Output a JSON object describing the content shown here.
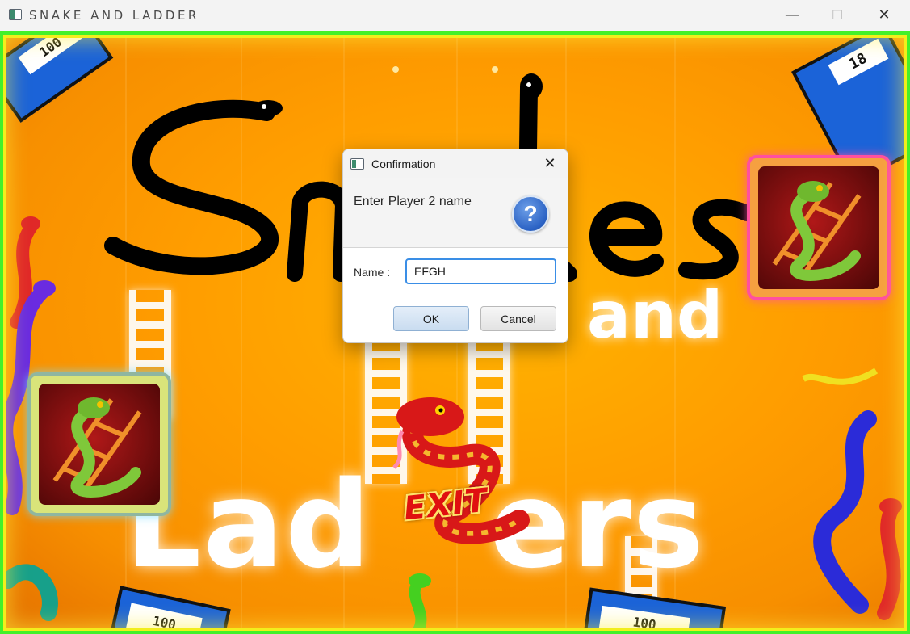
{
  "window": {
    "title": "SNAKE AND LADDER",
    "minimize_glyph": "—",
    "maximize_glyph": "☐",
    "close_glyph": "✕"
  },
  "game": {
    "title_word_1": "Snakes",
    "title_word_2": "and",
    "title_word_3_left": "Lad",
    "title_word_3_right": "ers",
    "exit_label": "EXIT",
    "board_labels": [
      "100",
      "18",
      "100",
      "100"
    ]
  },
  "dialog": {
    "title": "Confirmation",
    "close_glyph": "✕",
    "message": "Enter Player 2 name",
    "help_glyph": "?",
    "name_label": "Name :",
    "name_value": "EFGH",
    "ok_label": "OK",
    "cancel_label": "Cancel"
  },
  "colors": {
    "background_orange": "#ff9d00",
    "frame_green": "#43f02a",
    "frame_yellow": "#f2ee1c",
    "snake_title": "#000000",
    "exit_red": "#e01010",
    "help_blue": "#2b62c4",
    "focus_blue": "#3a8ee6"
  }
}
